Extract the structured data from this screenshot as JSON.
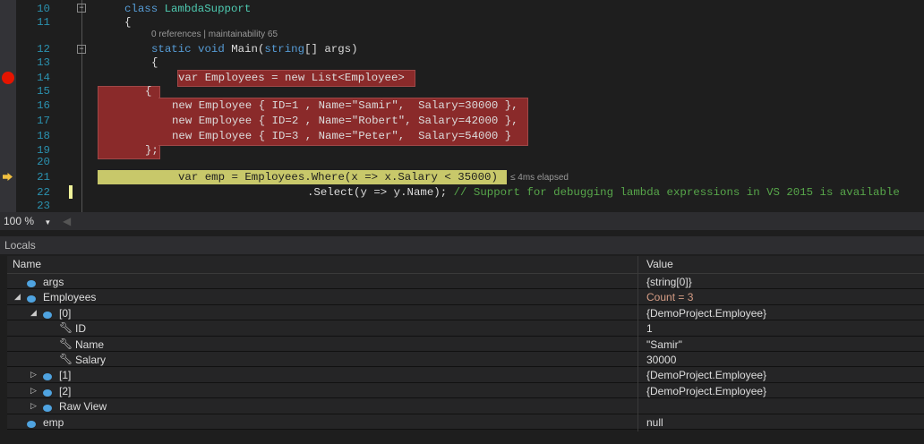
{
  "editor": {
    "lines": [
      {
        "n": "10"
      },
      {
        "n": "11"
      },
      {
        "n": "12"
      },
      {
        "n": "13"
      },
      {
        "n": "14"
      },
      {
        "n": "15"
      },
      {
        "n": "16"
      },
      {
        "n": "17"
      },
      {
        "n": "18"
      },
      {
        "n": "19"
      },
      {
        "n": "20"
      },
      {
        "n": "21"
      },
      {
        "n": "22"
      },
      {
        "n": "23"
      }
    ],
    "codelens": "0 references | maintainability 65",
    "l10": {
      "kw": "class",
      "name": "LambdaSupport"
    },
    "l11": "{",
    "l12": {
      "kw": "static void",
      "rest": "Main(",
      "kw2": "string",
      "rest2": "[] args)"
    },
    "l13": "{",
    "l14": "var Employees = new List<Employee>",
    "l15": "{",
    "l16": "new Employee { ID=1 , Name=\"Samir\",  Salary=30000 },",
    "l17": "new Employee { ID=2 , Name=\"Robert\", Salary=42000 },",
    "l18": "new Employee { ID=3 , Name=\"Peter\",  Salary=54000 }",
    "l19": "};",
    "l21": "var emp = Employees.Where(x => x.Salary < 35000)",
    "elapsed": "≤ 4ms elapsed",
    "l22": ".Select(y => y.Name);",
    "l22_comment": "// Support for debugging lambda expressions in VS 2015 is available"
  },
  "zoom": {
    "value": "100 %"
  },
  "locals": {
    "title": "Locals",
    "col_name": "Name",
    "col_value": "Value",
    "rows": [
      {
        "name": "args",
        "value": "{string[0]}"
      },
      {
        "name": "Employees",
        "value": "Count = 3"
      },
      {
        "name": "[0]",
        "value": "{DemoProject.Employee}"
      },
      {
        "name": "ID",
        "value": "1"
      },
      {
        "name": "Name",
        "value": "\"Samir\""
      },
      {
        "name": "Salary",
        "value": "30000"
      },
      {
        "name": "[1]",
        "value": "{DemoProject.Employee}"
      },
      {
        "name": "[2]",
        "value": "{DemoProject.Employee}"
      },
      {
        "name": "Raw View",
        "value": ""
      },
      {
        "name": "emp",
        "value": "null"
      }
    ]
  }
}
